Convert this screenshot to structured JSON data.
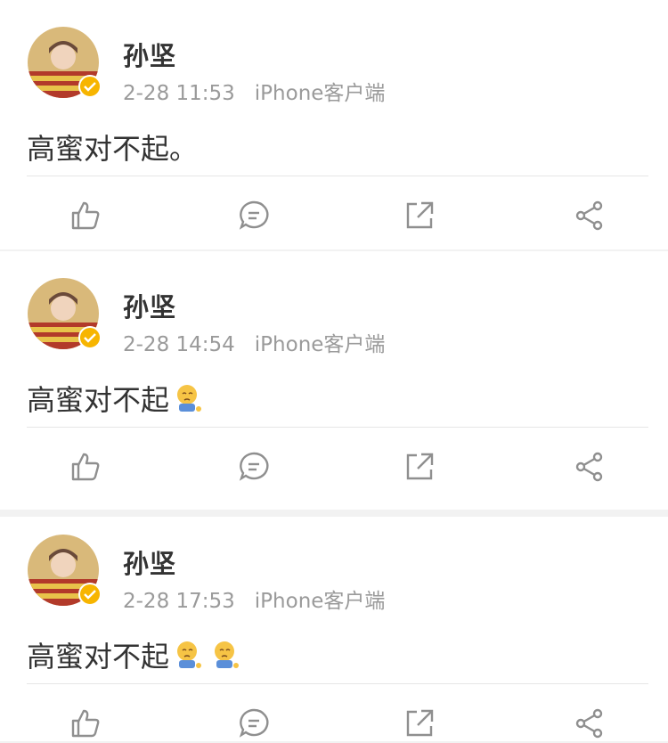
{
  "posts": [
    {
      "username": "孙坚",
      "time": "2-28 11:53",
      "source": "iPhone客户端",
      "text": "高蜜对不起。",
      "emojis": []
    },
    {
      "username": "孙坚",
      "time": "2-28 14:54",
      "source": "iPhone客户端",
      "text": "高蜜对不起",
      "emojis": [
        "sad-face-emoji"
      ]
    },
    {
      "username": "孙坚",
      "time": "2-28 17:53",
      "source": "iPhone客户端",
      "text": "高蜜对不起",
      "emojis": [
        "sad-face-emoji",
        "sad-face-emoji"
      ]
    }
  ],
  "actions": [
    "like-icon",
    "comment-icon",
    "repost-icon",
    "share-icon"
  ],
  "colors": {
    "verified_badge": "#f7b500",
    "meta_text": "#9a9a9a",
    "icon_stroke": "#8f8f8f"
  }
}
